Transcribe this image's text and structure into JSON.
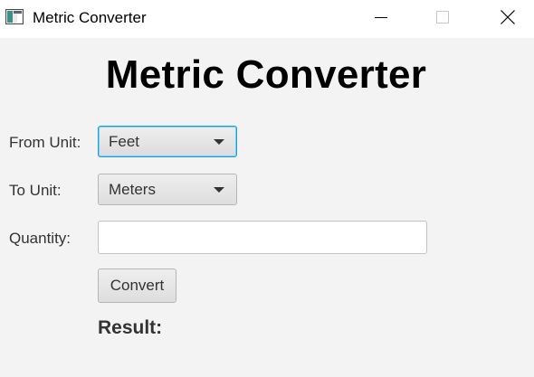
{
  "window": {
    "title": "Metric Converter",
    "controls": {
      "minimize_icon": "minimize-icon",
      "maximize_icon": "maximize-icon",
      "close_icon": "close-icon"
    }
  },
  "main": {
    "heading": "Metric Converter",
    "from_unit": {
      "label": "From Unit:",
      "selected": "Feet"
    },
    "to_unit": {
      "label": "To Unit:",
      "selected": "Meters"
    },
    "quantity": {
      "label": "Quantity:",
      "value": "",
      "placeholder": ""
    },
    "convert_button": "Convert",
    "result_label": "Result:"
  },
  "colors": {
    "focus_border": "#1a9ee6",
    "background": "#f3f3f3",
    "titlebar": "#ffffff"
  }
}
